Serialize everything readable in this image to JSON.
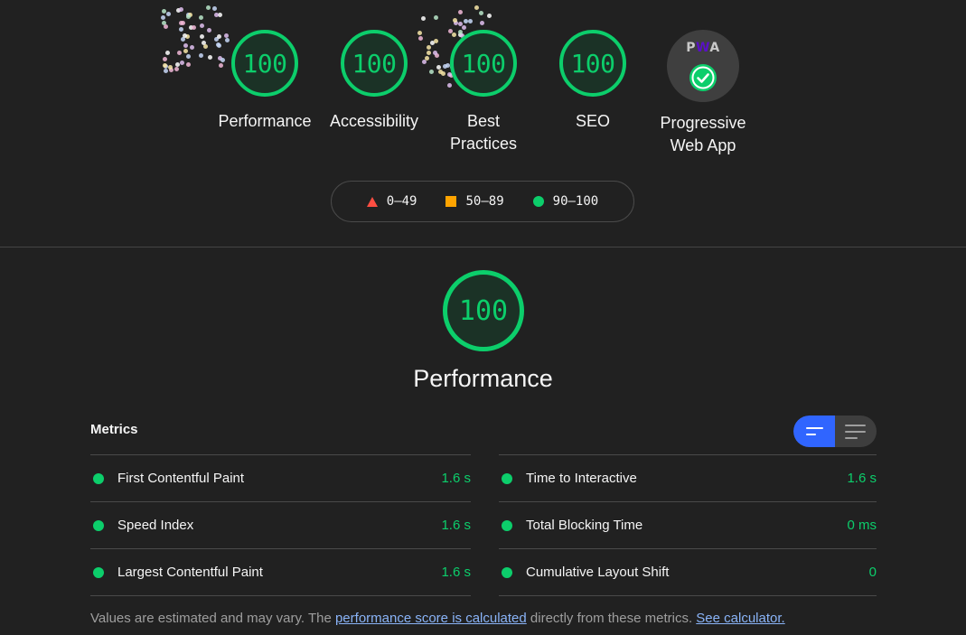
{
  "categories": [
    {
      "score": "100",
      "label": "Performance"
    },
    {
      "score": "100",
      "label": "Accessibility"
    },
    {
      "score": "100",
      "label": "Best Practices"
    },
    {
      "score": "100",
      "label": "SEO"
    }
  ],
  "pwa": {
    "badge_text_1": "P",
    "badge_text_2": "W",
    "badge_text_3": "A",
    "label": "Progressive Web App"
  },
  "legend": {
    "fail": "0–49",
    "average": "50–89",
    "pass": "90–100"
  },
  "performance": {
    "score": "100",
    "title": "Performance"
  },
  "metrics": {
    "header": "Metrics",
    "left": [
      {
        "name": "First Contentful Paint",
        "value": "1.6 s"
      },
      {
        "name": "Speed Index",
        "value": "1.6 s"
      },
      {
        "name": "Largest Contentful Paint",
        "value": "1.6 s"
      }
    ],
    "right": [
      {
        "name": "Time to Interactive",
        "value": "1.6 s"
      },
      {
        "name": "Total Blocking Time",
        "value": "0 ms"
      },
      {
        "name": "Cumulative Layout Shift",
        "value": "0"
      }
    ]
  },
  "footnote": {
    "text_1": "Values are estimated and may vary. The ",
    "link_1": "performance score is calculated",
    "text_2": " directly from these metrics. ",
    "link_2": "See calculator."
  },
  "colors": {
    "pass": "#0cce6b",
    "average": "#ffa400",
    "fail": "#ff4e42",
    "toggle_active": "#3065ff",
    "link": "#8ab4f8"
  }
}
